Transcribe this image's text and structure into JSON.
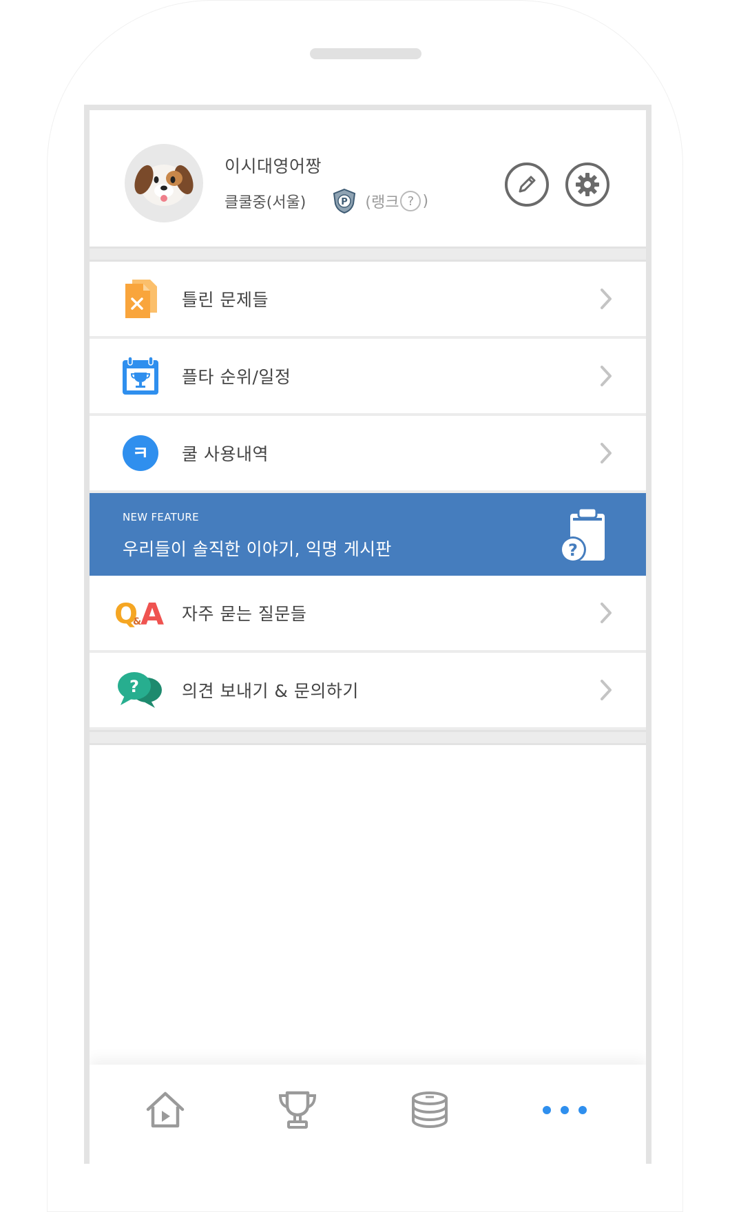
{
  "profile": {
    "nickname": "이시대영어짱",
    "status": "클쿨중(서울)",
    "rank_label_open": "(랭크",
    "rank_help": "?",
    "rank_label_close": ")"
  },
  "menu": [
    {
      "label": "틀린 문제들",
      "icon": "wrong-answers-icon"
    },
    {
      "label": "플타 순위/일정",
      "icon": "trophy-calendar-icon"
    },
    {
      "label": "쿨 사용내역",
      "icon": "kool-coin-icon",
      "badge": "ㅋ"
    }
  ],
  "banner": {
    "tag": "NEW FEATURE",
    "title": "우리들이 솔직한 이야기, 익명 게시판",
    "icon_glyph": "?"
  },
  "menu2": [
    {
      "label": "자주 묻는 질문들",
      "icon": "qna-icon",
      "logo_q": "Q",
      "logo_amp": "&",
      "logo_a": "A"
    },
    {
      "label": "의견 보내기 & 문의하기",
      "icon": "feedback-chat-icon",
      "glyph": "?"
    }
  ],
  "bottom_nav": [
    "home-icon",
    "trophy-icon",
    "coin-stack-icon",
    "more-icon"
  ],
  "colors": {
    "accent_blue": "#457dbe",
    "active_dot": "#2f8fee",
    "orange": "#f9a53c",
    "qna_orange": "#f5a623",
    "qna_red": "#ef5350",
    "chat_green": "#27ae8f"
  }
}
